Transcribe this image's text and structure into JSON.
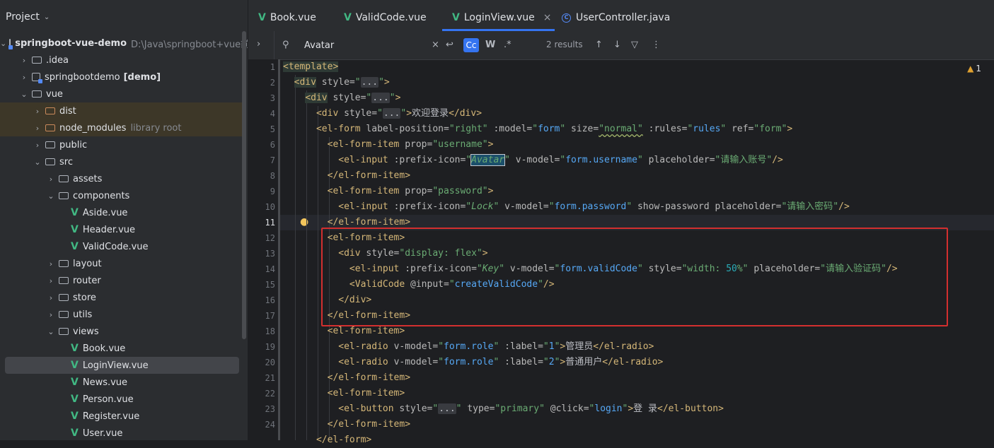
{
  "project_panel": {
    "title": "Project",
    "items": [
      {
        "label": "springboot-vue-demo",
        "extra": "D:\\Java\\springboot+vue前",
        "kind": "module"
      },
      {
        "label": ".idea",
        "kind": "folder"
      },
      {
        "label": "springbootdemo",
        "extra": "[demo]",
        "kind": "module"
      },
      {
        "label": "vue",
        "kind": "folder"
      },
      {
        "label": "dist",
        "kind": "folder-orange"
      },
      {
        "label": "node_modules",
        "extra": "library root",
        "kind": "folder-orange"
      },
      {
        "label": "public",
        "kind": "folder"
      },
      {
        "label": "src",
        "kind": "folder"
      },
      {
        "label": "assets",
        "kind": "folder"
      },
      {
        "label": "components",
        "kind": "folder"
      },
      {
        "label": "Aside.vue",
        "kind": "vue"
      },
      {
        "label": "Header.vue",
        "kind": "vue"
      },
      {
        "label": "ValidCode.vue",
        "kind": "vue"
      },
      {
        "label": "layout",
        "kind": "folder"
      },
      {
        "label": "router",
        "kind": "folder"
      },
      {
        "label": "store",
        "kind": "folder"
      },
      {
        "label": "utils",
        "kind": "folder"
      },
      {
        "label": "views",
        "kind": "folder"
      },
      {
        "label": "Book.vue",
        "kind": "vue"
      },
      {
        "label": "LoginView.vue",
        "kind": "vue",
        "selected": true
      },
      {
        "label": "News.vue",
        "kind": "vue"
      },
      {
        "label": "Person.vue",
        "kind": "vue"
      },
      {
        "label": "Register.vue",
        "kind": "vue"
      },
      {
        "label": "User.vue",
        "kind": "vue"
      }
    ]
  },
  "tabs": [
    {
      "label": "Book.vue",
      "icon": "vue-icon"
    },
    {
      "label": "ValidCode.vue",
      "icon": "vue-icon"
    },
    {
      "label": "LoginView.vue",
      "icon": "vue-icon",
      "active": true,
      "close": "×"
    },
    {
      "label": "UserController.java",
      "icon": "java-class-icon"
    }
  ],
  "search": {
    "query": "Avatar",
    "results": "2 results",
    "case_label": "Cc",
    "word_label": "W",
    "regex_label": ".*"
  },
  "editor": {
    "warning_count": "1",
    "current_line": "11",
    "line_numbers": [
      "1",
      "2",
      "3",
      "4",
      "5",
      "6",
      "7",
      "8",
      "9",
      "10",
      "11",
      "12",
      "13",
      "14",
      "15",
      "16",
      "17",
      "18",
      "19",
      "20",
      "21",
      "22",
      "23",
      "24"
    ],
    "dots": "...",
    "code": {
      "l4_text": "欢迎登录",
      "l7_placeholder": "请输入账号",
      "l10_placeholder": "请输入密码",
      "l14_placeholder": "请输入验证码",
      "l19_text": "管理员",
      "l20_text": "普通用户",
      "l23_text": "登 录"
    }
  },
  "colors": {
    "accent": "#3574f0",
    "highlight_box": "#d32f2f",
    "vue": "#41b883"
  }
}
